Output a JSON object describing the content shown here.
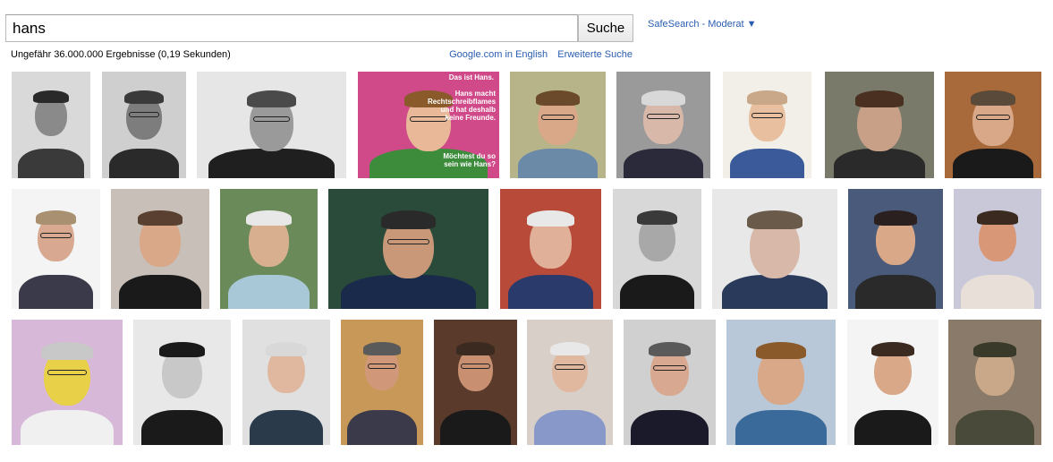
{
  "search": {
    "query": "hans",
    "button_label": "Suche"
  },
  "safesearch_label": "SafeSearch - Moderat ▼",
  "result_stats": "Ungefähr 36.000.000 Ergebnisse (0,19 Sekunden)",
  "links": {
    "english": "Google.com in English",
    "advanced": "Erweiterte Suche"
  },
  "meme": {
    "line1": "Das ist Hans.",
    "line2": "Hans macht Rechtschreibflames und hat deshalb keine Freunde.",
    "line3": "Möchtest du so sein wie Hans?"
  },
  "result_images": [
    {
      "bg": "#d9d9d9",
      "skin": "#8a8a8a",
      "shirt": "#3a3a3a",
      "hair": "#2a2a2a"
    },
    {
      "bg": "#cfcfcf",
      "skin": "#7d7d7d",
      "shirt": "#2a2a2a",
      "hair": "#3a3a3a"
    },
    {
      "bg": "#e6e6e6",
      "skin": "#9a9a9a",
      "shirt": "#1f1f1f",
      "hair": "#4a4a4a"
    },
    {
      "bg": "#d04a8a",
      "skin": "#e8b898",
      "shirt": "#3c8c3c",
      "hair": "#8a5a2a"
    },
    {
      "bg": "#b8b48a",
      "skin": "#d8a888",
      "shirt": "#6a8aa8",
      "hair": "#6a4a2a"
    },
    {
      "bg": "#9a9a9a",
      "skin": "#d8b8a8",
      "shirt": "#2a2a3a",
      "hair": "#d8d8d8"
    },
    {
      "bg": "#f2efe8",
      "skin": "#e8c0a0",
      "shirt": "#3a5a9a",
      "hair": "#c8a888"
    },
    {
      "bg": "#7a7a6a",
      "skin": "#c8a088",
      "shirt": "#2a2a2a",
      "hair": "#4a3020"
    },
    {
      "bg": "#a86a3a",
      "skin": "#d8a888",
      "shirt": "#1a1a1a",
      "hair": "#5a4a3a"
    },
    {
      "bg": "#f4f4f4",
      "skin": "#d8a890",
      "shirt": "#3a3a4a",
      "hair": "#a89070"
    },
    {
      "bg": "#c8c0b8",
      "skin": "#d8a888",
      "shirt": "#1a1a1a",
      "hair": "#5a4030"
    },
    {
      "bg": "#6a8a5a",
      "skin": "#d8b090",
      "shirt": "#a8c8d8",
      "hair": "#e8e8e8"
    },
    {
      "bg": "#2a4a3a",
      "skin": "#c89878",
      "shirt": "#1a2a4a",
      "hair": "#2a2a2a"
    },
    {
      "bg": "#b84a3a",
      "skin": "#e0b098",
      "shirt": "#2a3a6a",
      "hair": "#e8e8e8"
    },
    {
      "bg": "#d8d8d8",
      "skin": "#a8a8a8",
      "shirt": "#1a1a1a",
      "hair": "#3a3a3a"
    },
    {
      "bg": "#e8e8e8",
      "skin": "#d8b8a8",
      "shirt": "#2a3a5a",
      "hair": "#6a5a4a"
    },
    {
      "bg": "#4a5a7a",
      "skin": "#d8a888",
      "shirt": "#2a2a2a",
      "hair": "#2a2020"
    },
    {
      "bg": "#c8c8d8",
      "skin": "#d89878",
      "shirt": "#e8e0d8",
      "hair": "#3a2a20"
    },
    {
      "bg": "#d8b8d8",
      "skin": "#e8d048",
      "shirt": "#f0f0f0",
      "hair": "#c8c8c8"
    },
    {
      "bg": "#e8e8e8",
      "skin": "#c8c8c8",
      "shirt": "#1a1a1a",
      "hair": "#1a1a1a"
    },
    {
      "bg": "#e0e0e0",
      "skin": "#e0b8a0",
      "shirt": "#2a3a4a",
      "hair": "#d8d8d8"
    },
    {
      "bg": "#c89858",
      "skin": "#d09878",
      "shirt": "#3a3a4a",
      "hair": "#5a5a5a"
    },
    {
      "bg": "#5a3a2a",
      "skin": "#c89070",
      "shirt": "#1a1a1a",
      "hair": "#3a2a20"
    },
    {
      "bg": "#d8d0c8",
      "skin": "#e0b8a0",
      "shirt": "#8898c8",
      "hair": "#e8e8e8"
    },
    {
      "bg": "#d0d0d0",
      "skin": "#d8a890",
      "shirt": "#1a1a2a",
      "hair": "#5a5a5a"
    },
    {
      "bg": "#b8c8d8",
      "skin": "#d8a888",
      "shirt": "#3a6a9a",
      "hair": "#8a5a2a"
    },
    {
      "bg": "#f4f4f4",
      "skin": "#d8a888",
      "shirt": "#1a1a1a",
      "hair": "#3a2a20"
    },
    {
      "bg": "#8a7a6a",
      "skin": "#c8a888",
      "shirt": "#4a4a3a",
      "hair": "#3a3a2a"
    }
  ]
}
